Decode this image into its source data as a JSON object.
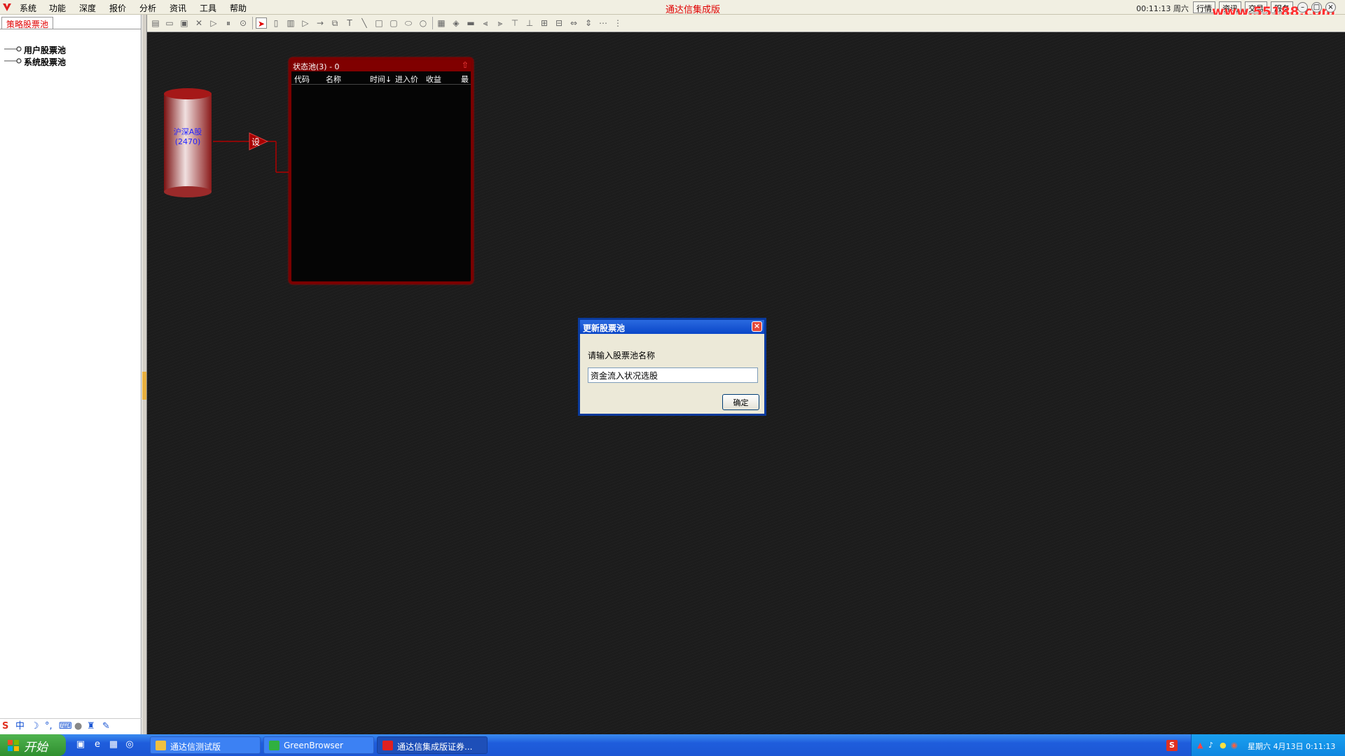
{
  "app": {
    "title": "通达信集成版",
    "menu": [
      "系统",
      "功能",
      "深度",
      "报价",
      "分析",
      "资讯",
      "工具",
      "帮助"
    ],
    "clock": "00:11:13 周六",
    "top_buttons": [
      "行情",
      "资讯",
      "交易",
      "服务"
    ],
    "watermark": "www.55188.com",
    "win_controls": [
      "–",
      "□",
      "×"
    ]
  },
  "sidebar": {
    "tab_label": "策略股票池",
    "tree": [
      {
        "label": "用户股票池"
      },
      {
        "label": "系统股票池"
      }
    ]
  },
  "canvas": {
    "source_node": {
      "name": "沪深A股",
      "count": "(2470)"
    },
    "filter_node": {
      "label": "设"
    },
    "pool_panel": {
      "title": "状态池(3) - 0",
      "columns": [
        "代码",
        "名称",
        "时间↓",
        "进入价",
        "收益",
        "最"
      ],
      "rows": []
    }
  },
  "dialog": {
    "title": "更新股票池",
    "prompt": "请输入股票池名称",
    "input_value": "资金流入状况选股",
    "ok_label": "确定",
    "close_label": "×"
  },
  "taskbar": {
    "start_label": "开始",
    "tasks": [
      {
        "label": "通达信测试版"
      },
      {
        "label": "GreenBrowser"
      },
      {
        "label": "通达信集成版证券..."
      }
    ],
    "tray_text": "星期六 4月13日 0:11:13",
    "sogou": "S"
  },
  "colors": {
    "canvas_bg": "#1c1c1c",
    "accent_red": "#e00000",
    "panel_border": "#7a0000",
    "dialog_title": "#0a46c8",
    "taskbar": "#1f5ddc"
  }
}
